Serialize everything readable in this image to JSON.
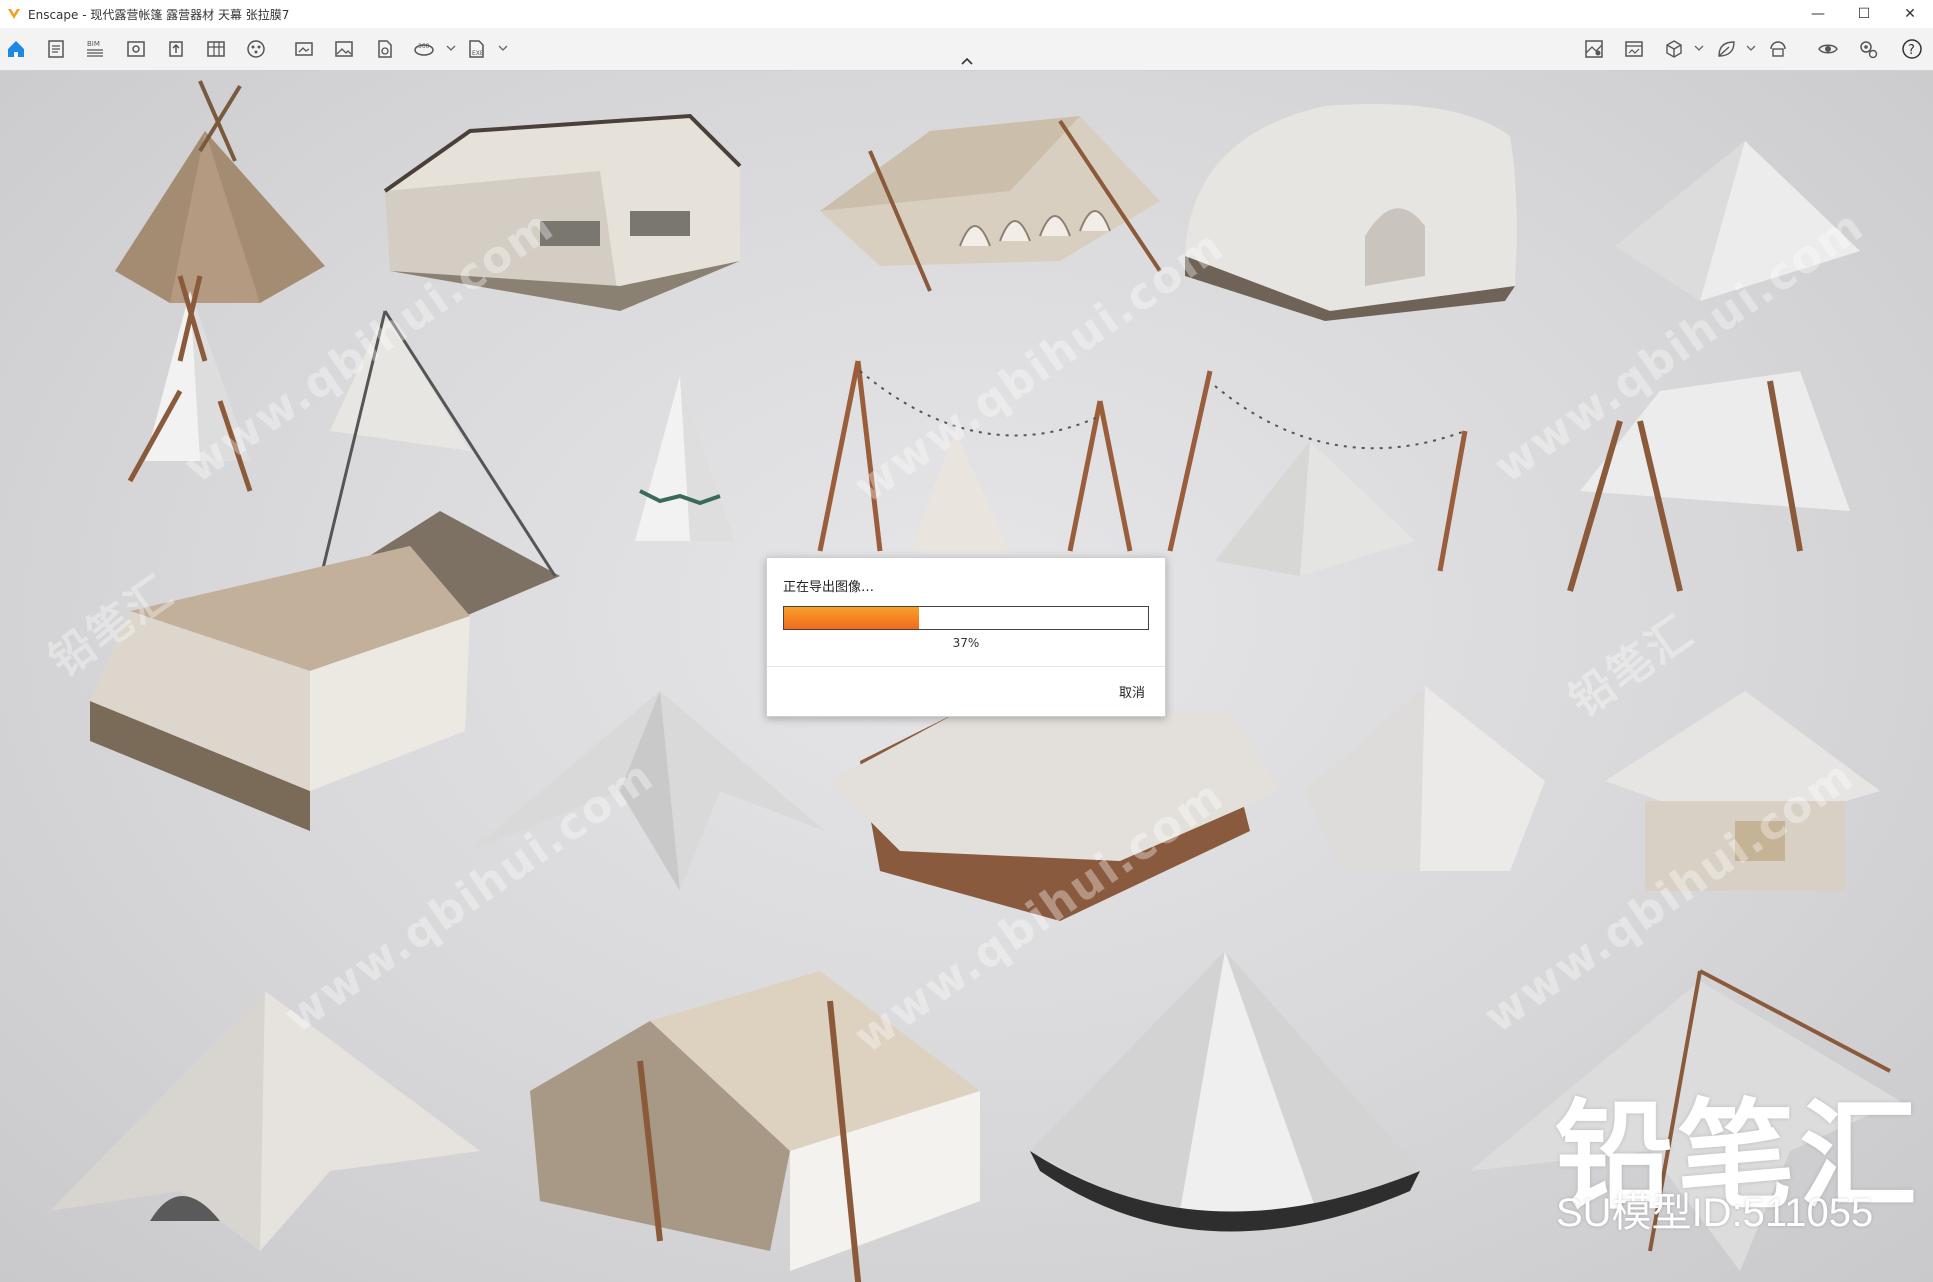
{
  "window": {
    "app_name": "Enscape",
    "separator": " - ",
    "document_title": "现代露营帐篷 露营器材 天幕 张拉膜7",
    "minimize": "—",
    "maximize": "☐",
    "close": "✕"
  },
  "toolbar": {
    "left_icons": [
      "home-icon",
      "doc-icon",
      "bim-icon",
      "view-icon",
      "upload-icon",
      "columns-icon",
      "sphere-icon",
      "screenshot-icon",
      "image-icon",
      "exe-icon",
      "panorama-360-icon",
      "export-icon"
    ],
    "right_icons": [
      "map-icon",
      "render-icon",
      "cube-icon",
      "leaf-icon",
      "asset-icon",
      "visibility-icon",
      "settings-icon",
      "help-icon"
    ],
    "accent": "#1e88e5",
    "help_label": "?"
  },
  "dialog": {
    "message": "正在导出图像…",
    "progress_percent": 37,
    "percent_label": "37%",
    "cancel_label": "取消",
    "fill_color": "#f26a1e"
  },
  "overlay": {
    "brand": "铅笔汇",
    "model_id": "SU模型ID:511055",
    "watermark_url": "www.qbihui.com",
    "watermark_cn": "铅笔汇"
  }
}
